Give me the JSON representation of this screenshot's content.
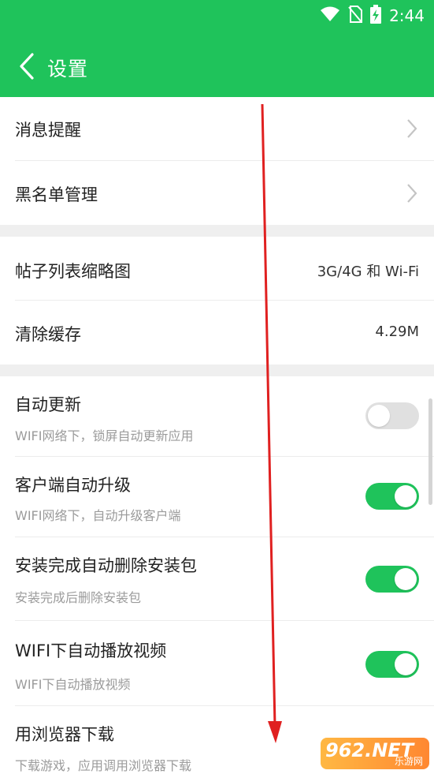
{
  "status_bar": {
    "time": "2:44",
    "icons": [
      "wifi-icon",
      "no-sim-icon",
      "battery-charging-icon"
    ]
  },
  "header": {
    "back_icon": "chevron-left-icon",
    "title": "设置"
  },
  "colors": {
    "brand_green": "#1fc35b",
    "toggle_off": "#e0e0e0",
    "section_gap": "#efefef",
    "annotation_red": "#e02020"
  },
  "sections": [
    {
      "rows": [
        {
          "title": "消息提醒",
          "action": "chevron-right-icon"
        },
        {
          "title": "黑名单管理",
          "action": "chevron-right-icon"
        }
      ]
    },
    {
      "rows": [
        {
          "title": "帖子列表缩略图",
          "value": "3G/4G 和 Wi-Fi"
        },
        {
          "title": "清除缓存",
          "value": "4.29M"
        }
      ]
    },
    {
      "rows": [
        {
          "title": "自动更新",
          "subtitle": "WIFI网络下，锁屏自动更新应用",
          "toggle": false
        },
        {
          "title": "客户端自动升级",
          "subtitle": "WIFI网络下，自动升级客户端",
          "toggle": true
        },
        {
          "title": "安装完成自动删除安装包",
          "subtitle": "安装完成后删除安装包",
          "toggle": true
        },
        {
          "title": "WIFI下自动播放视频",
          "subtitle": "WIFI下自动播放视频",
          "toggle": true
        },
        {
          "title": "用浏览器下载",
          "subtitle": "下载游戏，应用调用浏览器下载"
        }
      ]
    }
  ],
  "watermark": {
    "text": "962.NET",
    "sub": "乐游网"
  }
}
